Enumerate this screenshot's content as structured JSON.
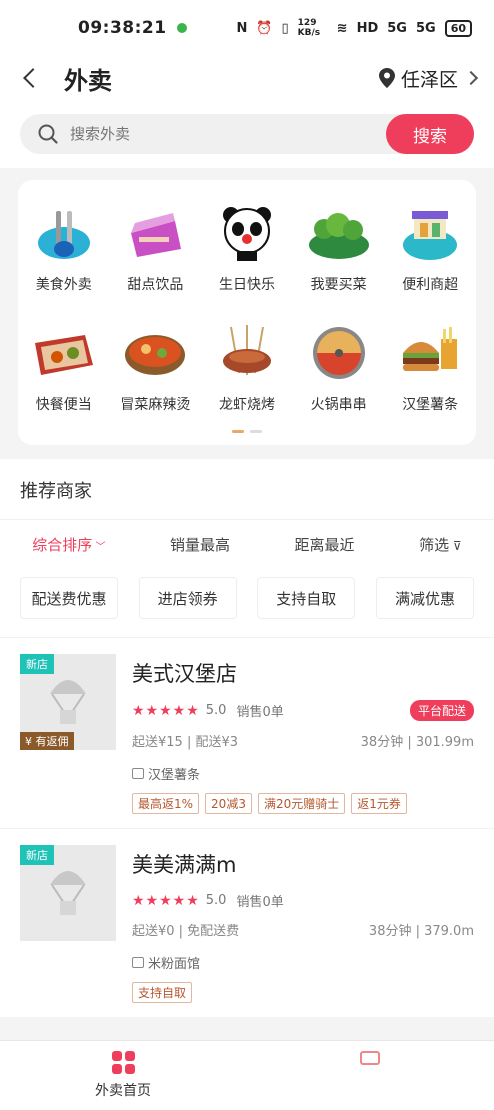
{
  "status": {
    "time": "09:38:21",
    "speed": "129 KB/s",
    "hd": "HD",
    "net1": "5G",
    "net2": "5G",
    "battery": "60"
  },
  "header": {
    "title": "外卖",
    "location": "任泽区"
  },
  "search": {
    "placeholder": "搜索外卖",
    "button": "搜索"
  },
  "categories": [
    {
      "label": "美食外卖",
      "icon": "food-delivery-icon"
    },
    {
      "label": "甜点饮品",
      "icon": "dessert-drink-icon"
    },
    {
      "label": "生日快乐",
      "icon": "birthday-panda-icon"
    },
    {
      "label": "我要买菜",
      "icon": "vegetable-icon"
    },
    {
      "label": "便利商超",
      "icon": "convenience-store-icon"
    },
    {
      "label": "快餐便当",
      "icon": "bento-icon"
    },
    {
      "label": "冒菜麻辣烫",
      "icon": "spicy-hotpot-bowl-icon"
    },
    {
      "label": "龙虾烧烤",
      "icon": "bbq-skewer-icon"
    },
    {
      "label": "火锅串串",
      "icon": "hotpot-icon"
    },
    {
      "label": "汉堡薯条",
      "icon": "burger-fries-icon"
    }
  ],
  "recommend": {
    "title": "推荐商家",
    "sort_tabs": [
      "综合排序",
      "销量最高",
      "距离最近",
      "筛选"
    ],
    "filters": [
      "配送费优惠",
      "进店领券",
      "支持自取",
      "满减优惠"
    ]
  },
  "shops": [
    {
      "name": "美式汉堡店",
      "tag_new": "新店",
      "tag_rebate": "¥ 有返佣",
      "stars": "★★★★★",
      "rating": "5.0",
      "sales": "销售0单",
      "badge": "平台配送",
      "cost": "起送¥15 | 配送¥3",
      "time_dist": "38分钟 | 301.99m",
      "category": "汉堡薯条",
      "promos": [
        "最高返1%",
        "20减3",
        "满20元赠骑士",
        "返1元券"
      ]
    },
    {
      "name": "美美满满m",
      "tag_new": "新店",
      "stars": "★★★★★",
      "rating": "5.0",
      "sales": "销售0单",
      "cost": "起送¥0 | 免配送费",
      "time_dist": "38分钟 | 379.0m",
      "category": "米粉面馆",
      "promos": [
        "支持自取"
      ]
    }
  ],
  "tabbar": {
    "home": "外卖首页"
  }
}
